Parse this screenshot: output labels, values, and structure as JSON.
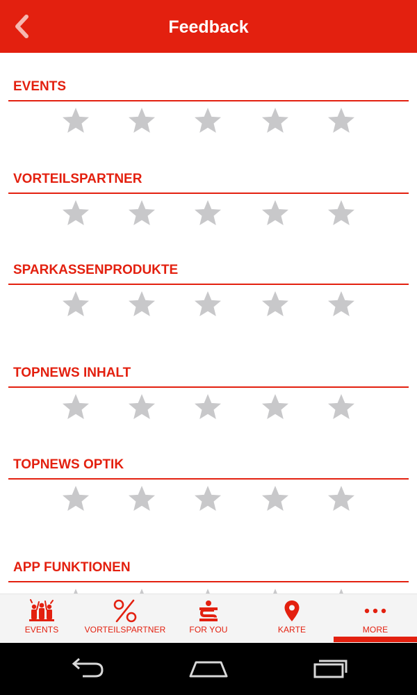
{
  "header": {
    "title": "Feedback",
    "back_icon": "chevron-left-icon"
  },
  "colors": {
    "accent": "#e3200f",
    "star_inactive": "#c8c8ca",
    "tabbar_bg": "#f4f4f4",
    "navbar_bg": "#000000"
  },
  "sections": [
    {
      "title": "EVENTS",
      "rating": 0,
      "max_rating": 5
    },
    {
      "title": "VORTEILSPARTNER",
      "rating": 0,
      "max_rating": 5
    },
    {
      "title": "SPARKASSENPRODUKTE",
      "rating": 0,
      "max_rating": 5
    },
    {
      "title": "TOPNEWS INHALT",
      "rating": 0,
      "max_rating": 5
    },
    {
      "title": "TOPNEWS OPTIK",
      "rating": 0,
      "max_rating": 5
    },
    {
      "title": "APP FUNKTIONEN",
      "rating": 0,
      "max_rating": 5
    }
  ],
  "tabs": [
    {
      "label": "EVENTS",
      "icon": "crowd-icon",
      "active": false
    },
    {
      "label": "VORTEILSPARTNER",
      "icon": "percent-icon",
      "active": false
    },
    {
      "label": "FOR YOU",
      "icon": "sparkasse-logo-icon",
      "active": false
    },
    {
      "label": "KARTE",
      "icon": "map-pin-icon",
      "active": false
    },
    {
      "label": "MORE",
      "icon": "more-dots-icon",
      "active": true
    }
  ],
  "system_nav": [
    {
      "icon": "back-arrow-icon"
    },
    {
      "icon": "home-icon"
    },
    {
      "icon": "recent-apps-icon"
    }
  ]
}
